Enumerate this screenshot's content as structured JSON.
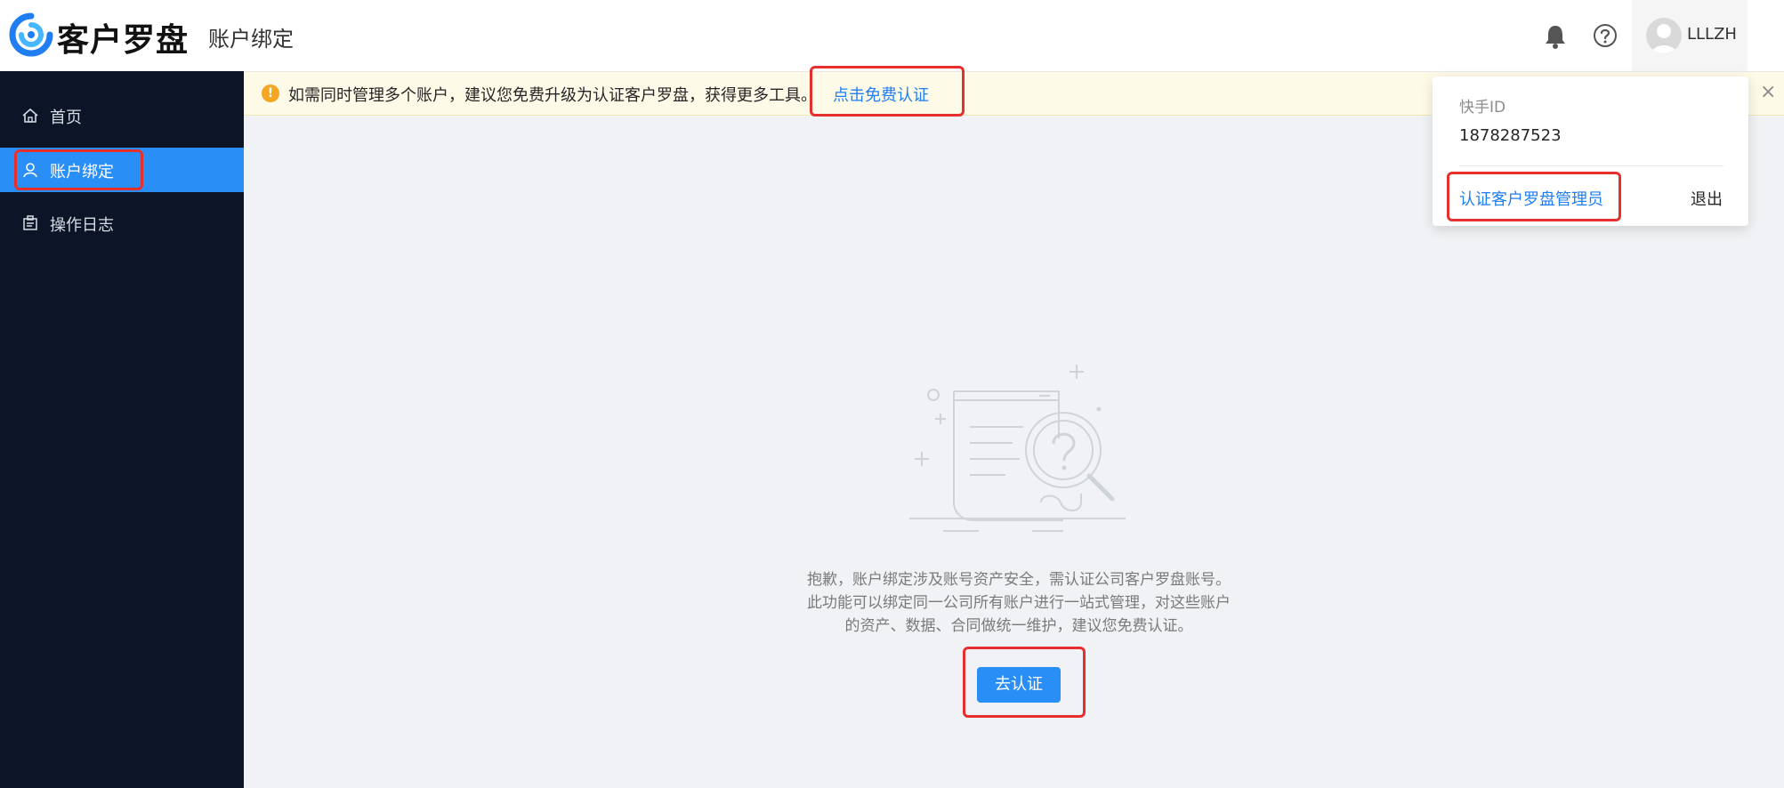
{
  "header": {
    "brand": "客户罗盘",
    "page_title": "账户绑定",
    "user_name": "LLLZH"
  },
  "sidebar": {
    "items": [
      {
        "label": "首页",
        "icon": "home-icon",
        "active": false
      },
      {
        "label": "账户绑定",
        "icon": "user-icon",
        "active": true
      },
      {
        "label": "操作日志",
        "icon": "log-icon",
        "active": false
      }
    ]
  },
  "notice": {
    "text": "如需同时管理多个账户，建议您免费升级为认证客户罗盘，获得更多工具。",
    "link": "点击免费认证",
    "close": "×"
  },
  "popover": {
    "id_label": "快手ID",
    "id_value": "1878287523",
    "admin_link": "认证客户罗盘管理员",
    "logout": "退出"
  },
  "empty_state": {
    "line1": "抱歉，账户绑定涉及账号资产安全，需认证公司客户罗盘账号。",
    "line2": "此功能可以绑定同一公司所有账户进行一站式管理，对这些账户",
    "line3": "的资产、数据、合同做统一维护，建议您免费认证。",
    "button": "去认证"
  },
  "colors": {
    "primary": "#2a8ef7",
    "sidebar_bg": "#0b1527",
    "notice_bg": "#fefae8",
    "annotation_red": "#e5302d"
  }
}
